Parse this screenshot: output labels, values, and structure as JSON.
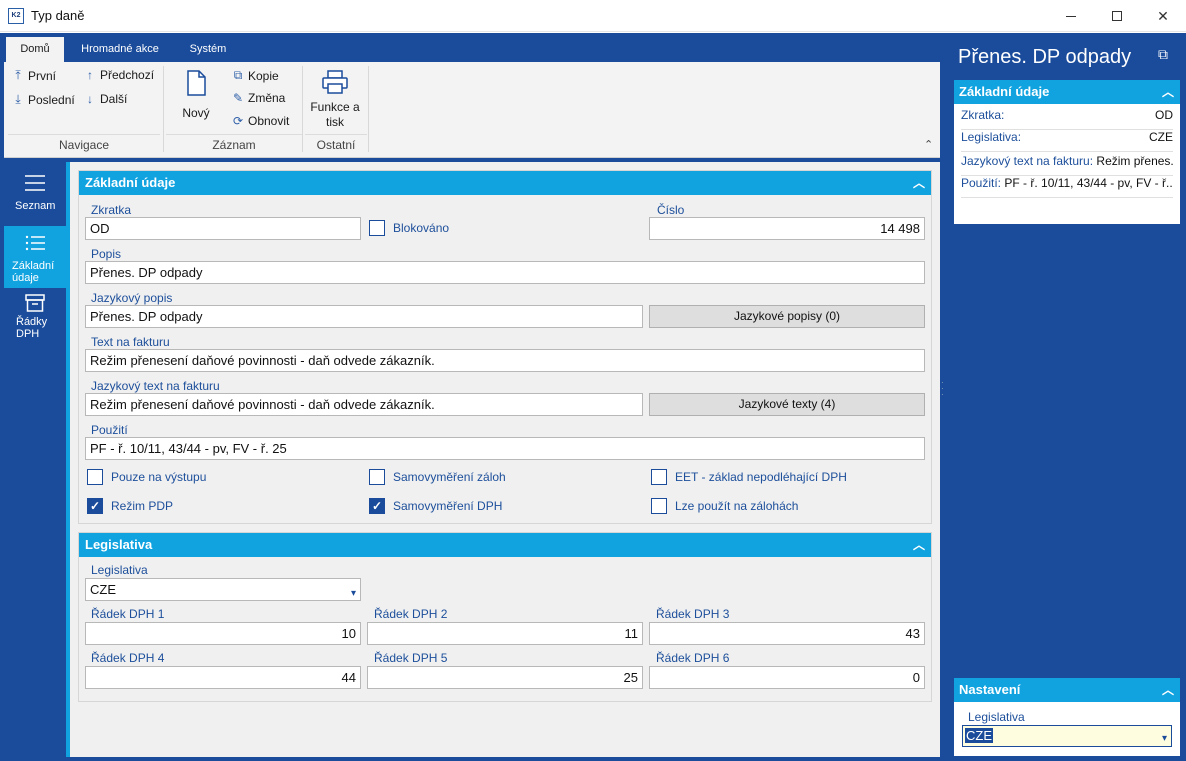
{
  "window": {
    "title": "Typ daně",
    "app_icon": "K2"
  },
  "ribbon": {
    "tabs": [
      "Domů",
      "Hromadné akce",
      "Systém"
    ],
    "navigation": {
      "first": "První",
      "previous": "Předchozí",
      "last": "Poslední",
      "next": "Další",
      "group_label": "Navigace"
    },
    "record": {
      "new": "Nový",
      "copy": "Kopie",
      "change": "Změna",
      "refresh": "Obnovit",
      "group_label": "Záznam"
    },
    "other": {
      "print_line1": "Funkce a",
      "print_line2": "tisk",
      "group_label": "Ostatní"
    }
  },
  "leftnav": {
    "items": [
      {
        "label_line1": "Seznam",
        "label_line2": ""
      },
      {
        "label_line1": "Základní",
        "label_line2": "údaje"
      },
      {
        "label_line1": "Řádky",
        "label_line2": "DPH"
      }
    ]
  },
  "basic": {
    "header": "Základní údaje",
    "abbrev_label": "Zkratka",
    "abbrev_value": "OD",
    "blocked_label": "Blokováno",
    "number_label": "Číslo",
    "number_value": "14 498",
    "desc_label": "Popis",
    "desc_value": "Přenes. DP odpady",
    "lang_desc_label": "Jazykový popis",
    "lang_desc_value": "Přenes. DP odpady",
    "lang_desc_button": "Jazykové popisy (0)",
    "invoice_text_label": "Text na fakturu",
    "invoice_text_value": "Režim přenesení daňové povinnosti - daň odvede zákazník.",
    "lang_invoice_text_label": "Jazykový text na fakturu",
    "lang_invoice_text_value": "Režim přenesení daňové povinnosti - daň odvede zákazník.",
    "lang_texts_button": "Jazykové texty (4)",
    "usage_label": "Použití",
    "usage_value": "PF - ř. 10/11, 43/44 - pv, FV - ř. 25",
    "checkboxes": {
      "output_only": "Pouze na výstupu",
      "self_assess_adv": "Samovyměření záloh",
      "eet": "EET - základ nepodléhající DPH",
      "pdp": "Režim PDP",
      "self_assess_vat": "Samovyměření DPH",
      "usable_on_adv": "Lze použít na zálohách"
    },
    "checked": {
      "output_only": false,
      "self_assess_adv": false,
      "eet": false,
      "pdp": true,
      "self_assess_vat": true,
      "usable_on_adv": false
    }
  },
  "legislation": {
    "header": "Legislativa",
    "leg_label": "Legislativa",
    "leg_value": "CZE",
    "rows": [
      {
        "label": "Řádek DPH 1",
        "value": "10"
      },
      {
        "label": "Řádek DPH 2",
        "value": "11"
      },
      {
        "label": "Řádek DPH 3",
        "value": "43"
      },
      {
        "label": "Řádek DPH 4",
        "value": "44"
      },
      {
        "label": "Řádek DPH 5",
        "value": "25"
      },
      {
        "label": "Řádek DPH 6",
        "value": "0"
      }
    ]
  },
  "right_panel": {
    "title": "Přenes. DP odpady",
    "basic_header": "Základní údaje",
    "abbrev_key": "Zkratka:",
    "abbrev_val": "OD",
    "leg_key": "Legislativa:",
    "leg_val": "CZE",
    "lang_text_key": "Jazykový text na fakturu:",
    "lang_text_val": "Režim přenes...",
    "usage_key": "Použití:",
    "usage_val": "PF - ř. 10/11, 43/44 - pv, FV - ř....",
    "settings_header": "Nastavení",
    "settings_leg_label": "Legislativa",
    "settings_leg_value": "CZE"
  },
  "colors": {
    "frame_blue": "#1b4c9b",
    "accent_cyan": "#10a3e0"
  }
}
